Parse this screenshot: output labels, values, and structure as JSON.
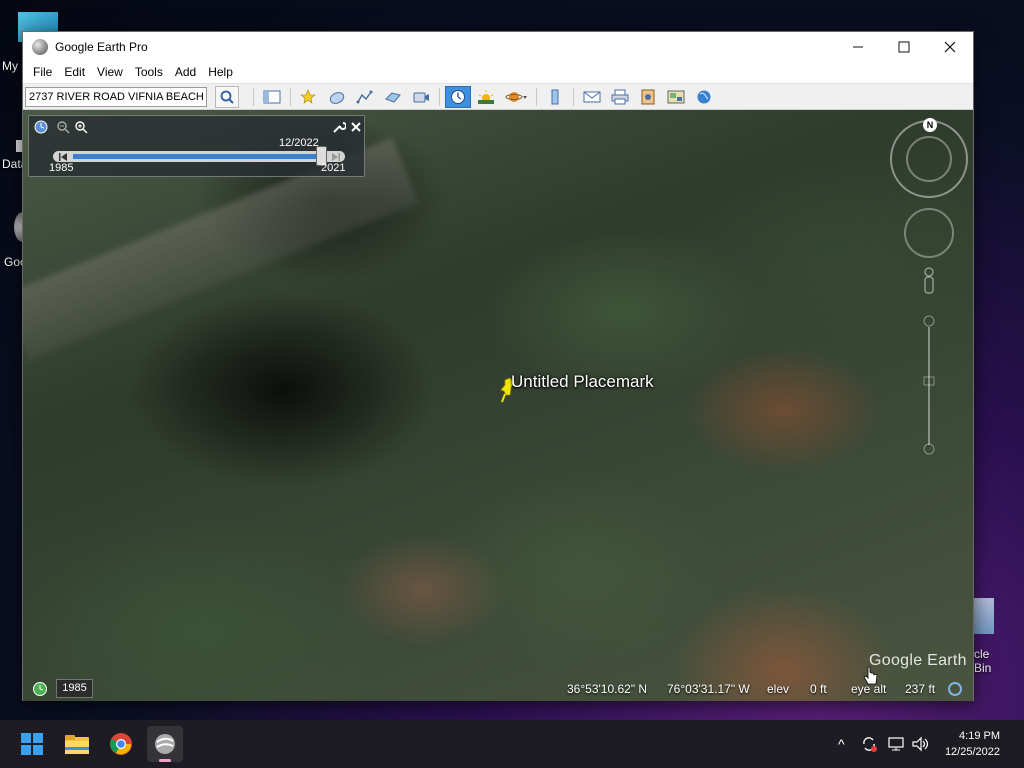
{
  "desktop": {
    "icons": [
      {
        "label": "My"
      },
      {
        "label": "Data"
      },
      {
        "label": "Goo"
      },
      {
        "label": "cle Bin"
      }
    ]
  },
  "window": {
    "title": "Google Earth Pro",
    "controls": {
      "minimize": "—",
      "maximize": "☐",
      "close": "✕"
    }
  },
  "menu": {
    "items": [
      "File",
      "Edit",
      "View",
      "Tools",
      "Add",
      "Help"
    ]
  },
  "toolbar": {
    "search_value": "2737 RIVER ROAD VIFNIA BEACH",
    "buttons": [
      "sidebar-toggle-icon",
      "placemark-icon",
      "polygon-icon",
      "path-icon",
      "image-overlay-icon",
      "record-tour-icon",
      "historical-imagery-icon",
      "sunlight-icon",
      "planets-icon",
      "ruler-icon",
      "email-icon",
      "print-icon",
      "save-image-icon",
      "view-in-maps-icon",
      "earth-icon"
    ],
    "active_button": "historical-imagery-icon",
    "accent_color": "#3d8fe0"
  },
  "time_slider": {
    "current_date": "12/2022",
    "start_year": "1985",
    "end_year": "2021",
    "position_fraction": 0.92
  },
  "map": {
    "placemark_label": "Untitled Placemark",
    "placemark_color": "#f2e600",
    "compass_north": "N",
    "brand": "Google Earth"
  },
  "status": {
    "imagery_year": "1985",
    "latitude": "36°53'10.62\" N",
    "longitude": "76°03'31.17\" W",
    "elev_label": "elev",
    "elev_value": "0 ft",
    "eye_alt_label": "eye alt",
    "eye_alt_value": "237 ft"
  },
  "taskbar": {
    "apps": [
      "windows-start-icon",
      "file-explorer-icon",
      "chrome-icon",
      "google-earth-icon"
    ],
    "tray_chevron": "^",
    "time": "4:19 PM",
    "date": "12/25/2022"
  }
}
